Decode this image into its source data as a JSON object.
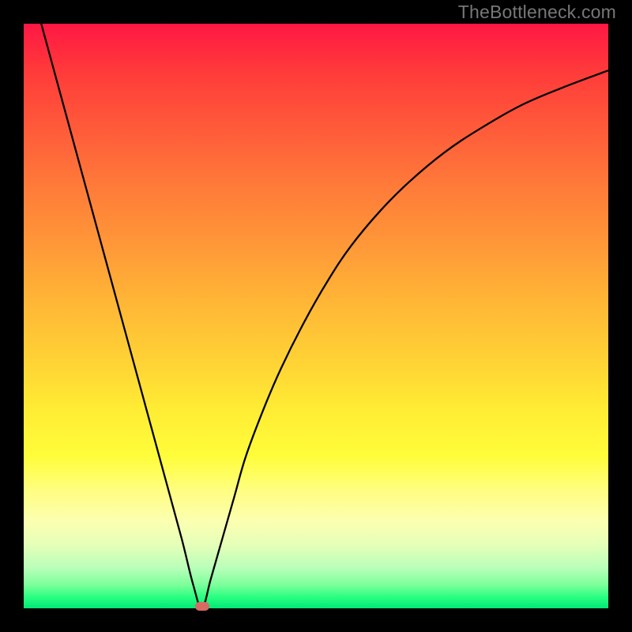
{
  "watermark": "TheBottleneck.com",
  "chart_data": {
    "type": "line",
    "title": "",
    "xlabel": "",
    "ylabel": "",
    "xlim": [
      0,
      100
    ],
    "ylim": [
      0,
      100
    ],
    "grid": false,
    "legend": false,
    "minimum_point": {
      "x": 30.5,
      "y": 0
    },
    "series": [
      {
        "name": "bottleneck-curve",
        "x": [
          3,
          6,
          9,
          12,
          15,
          18,
          21,
          24,
          27,
          29,
          30.5,
          32,
          34,
          36,
          38,
          41,
          44,
          48,
          52,
          56,
          61,
          66,
          72,
          78,
          85,
          92,
          100
        ],
        "values": [
          100,
          89,
          78,
          67,
          56,
          45,
          34,
          23,
          12,
          4,
          0,
          5,
          12,
          19,
          26,
          34,
          41,
          49,
          56,
          62,
          68,
          73,
          78,
          82,
          86,
          89,
          92
        ]
      }
    ],
    "background_gradient": {
      "top": "#ff1744",
      "mid": "#fffd3a",
      "bottom": "#00e876"
    }
  }
}
